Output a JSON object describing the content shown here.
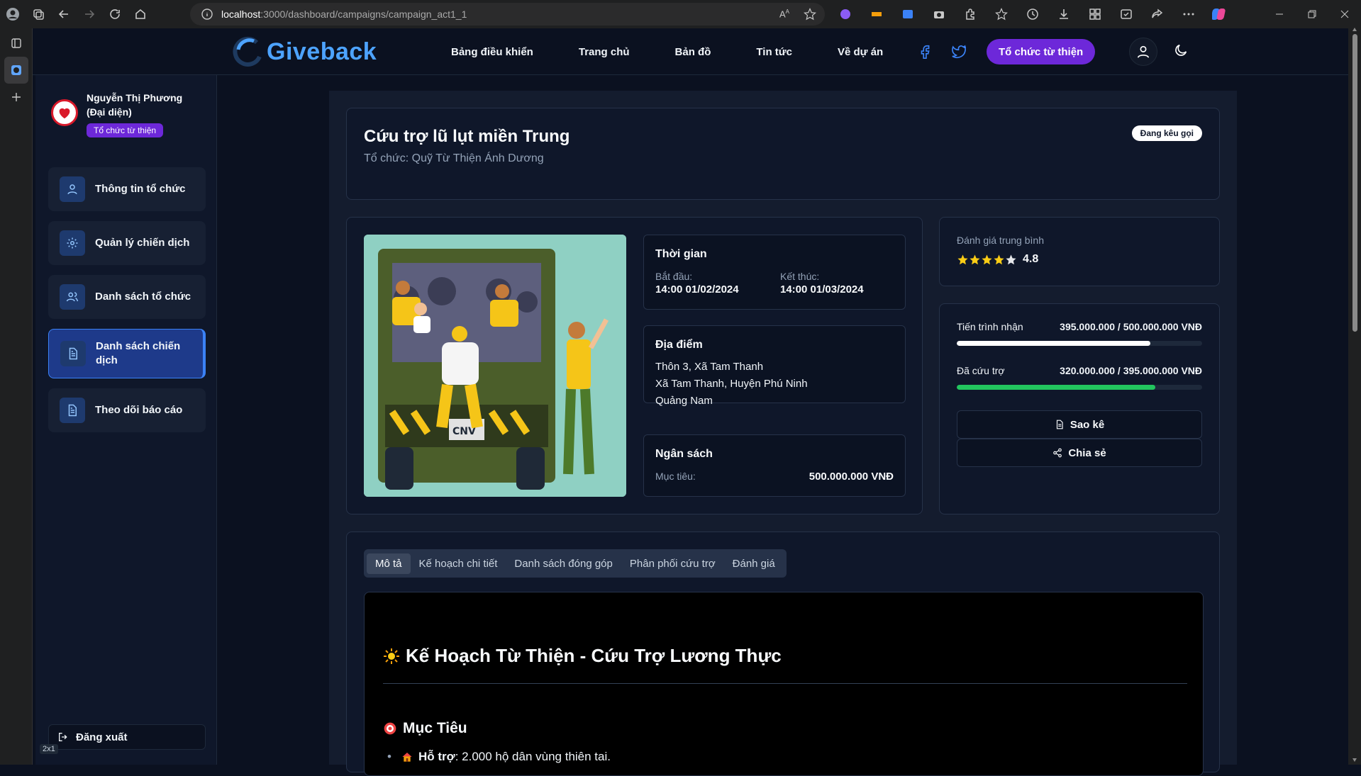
{
  "browser": {
    "url_host": "localhost",
    "url_path": ":3000/dashboard/campaigns/campaign_act1_1",
    "zoom_badge": "2x1"
  },
  "header": {
    "logo_text": "Giveback",
    "nav": [
      "Bảng điều khiển",
      "Trang chủ",
      "Bản đồ",
      "Tin tức",
      "Về dự án"
    ],
    "org_button": "Tổ chức từ thiện"
  },
  "sidebar": {
    "user_name": "Nguyễn Thị Phương (Đại diện)",
    "role_badge": "Tổ chức từ thiện",
    "items": [
      {
        "label": "Thông tin tổ chức",
        "icon": "user-icon"
      },
      {
        "label": "Quản lý chiến dịch",
        "icon": "gear-icon"
      },
      {
        "label": "Danh sách tổ chức",
        "icon": "users-icon"
      },
      {
        "label": "Danh sách chiến dịch",
        "icon": "document-icon",
        "active": true
      },
      {
        "label": "Theo dõi báo cáo",
        "icon": "document-icon"
      }
    ],
    "logout": "Đăng xuất"
  },
  "campaign": {
    "title": "Cứu trợ lũ lụt miền Trung",
    "org": "Tổ chức: Quỹ Từ Thiện Ánh Dương",
    "status": "Đang kêu gọi",
    "time": {
      "title": "Thời gian",
      "start_label": "Bắt đầu:",
      "start_value": "14:00 01/02/2024",
      "end_label": "Kết thúc:",
      "end_value": "14:00 01/03/2024"
    },
    "location": {
      "title": "Địa điểm",
      "lines": [
        "Thôn 3, Xã Tam Thanh",
        "Xã Tam Thanh, Huyện Phú Ninh",
        "Quảng Nam"
      ]
    },
    "budget": {
      "title": "Ngân sách",
      "target_label": "Mục tiêu:",
      "target_value": "500.000.000 VNĐ"
    }
  },
  "rating": {
    "label": "Đánh giá trung bình",
    "value": "4.8",
    "stars": 4.8
  },
  "progress": {
    "received_label": "Tiến trình nhận",
    "received_value": "395.000.000 / 500.000.000 VNĐ",
    "received_ratio": 0.79,
    "relief_label": "Đã cứu trợ",
    "relief_value": "320.000.000 / 395.000.000 VNĐ",
    "relief_ratio": 0.81,
    "colors": {
      "received": "#ffffff",
      "relief": "#22c55e"
    }
  },
  "actions": {
    "statement": "Sao kê",
    "share": "Chia sẻ"
  },
  "tabs": [
    "Mô tả",
    "Kế hoạch chi tiết",
    "Danh sách đóng góp",
    "Phân phối cứu trợ",
    "Đánh giá"
  ],
  "description": {
    "h1": "Kế Hoạch Từ Thiện - Cứu Trợ Lương Thực",
    "h2": "Mục Tiêu",
    "li_bold": "Hỗ trợ",
    "li_text": ": 2.000 hộ dân vùng thiên tai."
  }
}
